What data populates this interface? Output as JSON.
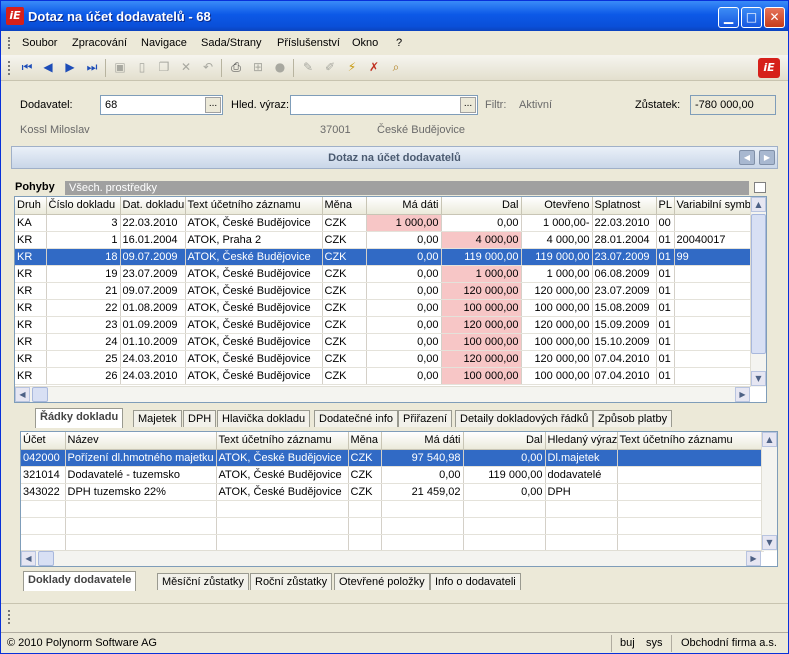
{
  "window": {
    "title": "Dotaz na účet dodavatelů - 68",
    "app_icon": "iE"
  },
  "menu": [
    "Soubor",
    "Zpracování",
    "Navigace",
    "Sada/Strany",
    "Příslušenství",
    "Okno",
    "?"
  ],
  "toolbar": {
    "icons": [
      "first-record-icon",
      "prev-record-icon",
      "next-record-icon",
      "last-record-icon",
      "save-icon",
      "new-icon",
      "copy-icon",
      "delete-icon",
      "undo-icon",
      "print-icon",
      "tree-icon",
      "lock-icon",
      "pen-icon",
      "pen2-icon",
      "filter-icon",
      "clear-filter-icon",
      "search-icon"
    ],
    "logo": "iE"
  },
  "header": {
    "dodavatel_label": "Dodavatel:",
    "dodavatel_value": "68",
    "hled_label": "Hled. výraz:",
    "hled_value": "",
    "filtr_label": "Filtr:",
    "filtr_value": "Aktivní",
    "zustatek_label": "Zůstatek:",
    "zustatek_value": "-780 000,00",
    "name": "Kossl Miloslav",
    "zip": "37001",
    "city": "České Budějovice",
    "dots": "..."
  },
  "section": {
    "title": "Dotaz na účet dodavatelů"
  },
  "pohyby": {
    "label": "Pohyby",
    "value": "Všech. prostředky"
  },
  "main_table": {
    "columns": [
      "Druh",
      "Číslo dokladu",
      "Dat. dokladu",
      "Text účetního záznamu",
      "Měna",
      "Má dáti",
      "Dal",
      "Otevřeno",
      "Splatnost",
      "PL",
      "Variabilní symb."
    ],
    "rows": [
      [
        "KA",
        "3",
        "22.03.2010",
        "ATOK, České Budějovice",
        "CZK",
        "1 000,00",
        "0,00",
        "1 000,00-",
        "22.03.2010",
        "00",
        ""
      ],
      [
        "KR",
        "1",
        "16.01.2004",
        "ATOK, Praha 2",
        "CZK",
        "0,00",
        "4 000,00",
        "4 000,00",
        "28.01.2004",
        "01",
        "20040017"
      ],
      [
        "KR",
        "18",
        "09.07.2009",
        "ATOK, České Budějovice",
        "CZK",
        "0,00",
        "119 000,00",
        "119 000,00",
        "23.07.2009",
        "01",
        "99"
      ],
      [
        "KR",
        "19",
        "23.07.2009",
        "ATOK, České Budějovice",
        "CZK",
        "0,00",
        "1 000,00",
        "1 000,00",
        "06.08.2009",
        "01",
        ""
      ],
      [
        "KR",
        "21",
        "09.07.2009",
        "ATOK, České Budějovice",
        "CZK",
        "0,00",
        "120 000,00",
        "120 000,00",
        "23.07.2009",
        "01",
        ""
      ],
      [
        "KR",
        "22",
        "01.08.2009",
        "ATOK, České Budějovice",
        "CZK",
        "0,00",
        "100 000,00",
        "100 000,00",
        "15.08.2009",
        "01",
        ""
      ],
      [
        "KR",
        "23",
        "01.09.2009",
        "ATOK, České Budějovice",
        "CZK",
        "0,00",
        "120 000,00",
        "120 000,00",
        "15.09.2009",
        "01",
        ""
      ],
      [
        "KR",
        "24",
        "01.10.2009",
        "ATOK, České Budějovice",
        "CZK",
        "0,00",
        "100 000,00",
        "100 000,00",
        "15.10.2009",
        "01",
        ""
      ],
      [
        "KR",
        "25",
        "24.03.2010",
        "ATOK, České Budějovice",
        "CZK",
        "0,00",
        "120 000,00",
        "120 000,00",
        "07.04.2010",
        "01",
        ""
      ],
      [
        "KR",
        "26",
        "24.03.2010",
        "ATOK, České Budějovice",
        "CZK",
        "0,00",
        "100 000,00",
        "100 000,00",
        "07.04.2010",
        "01",
        ""
      ]
    ],
    "selected_row": 2
  },
  "detail_tabs": [
    "Řádky dokladu",
    "Majetek",
    "DPH",
    "Hlavička dokladu",
    "Dodatečné info",
    "Přiřazení",
    "Detaily dokladových řádků",
    "Způsob platby"
  ],
  "detail_table": {
    "columns": [
      "Účet",
      "Název",
      "Text účetního záznamu",
      "Měna",
      "Má dáti",
      "Dal",
      "Hledaný výraz",
      "Text účetního záznamu"
    ],
    "rows": [
      [
        "042000",
        "Pořízení dl.hmotného majetku",
        "ATOK, České Budějovice",
        "CZK",
        "97 540,98",
        "0,00",
        "Dl.majetek",
        ""
      ],
      [
        "321014",
        "Dodavatelé - tuzemsko",
        "ATOK, České Budějovice",
        "CZK",
        "0,00",
        "119 000,00",
        "dodavatelé",
        ""
      ],
      [
        "343022",
        "DPH tuzemsko 22%",
        "ATOK, České Budějovice",
        "CZK",
        "21 459,02",
        "0,00",
        "DPH",
        ""
      ]
    ],
    "selected_row": 0
  },
  "bottom_tabs": [
    "Doklady dodavatele",
    "Měsíční zůstatky",
    "Roční zůstatky",
    "Otevřené položky",
    "Info o dodavateli"
  ],
  "status": {
    "copyright": "© 2010 Polynorm Software AG",
    "user": "buj",
    "sys": "sys",
    "company": "Obchodní firma a.s."
  }
}
